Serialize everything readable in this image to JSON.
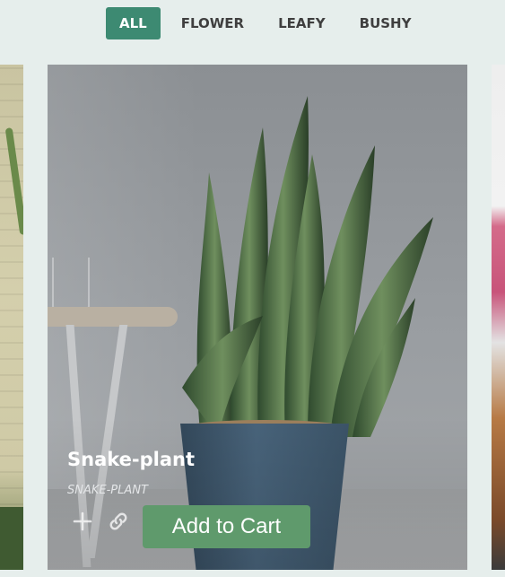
{
  "filters": {
    "all": "ALL",
    "flower": "FLOWER",
    "leafy": "LEAFY",
    "bushy": "BUSHY"
  },
  "product": {
    "name": "Snake-plant",
    "sku": "SNAKE-PLANT",
    "add_to_cart": "Add to Cart"
  },
  "icons": {
    "add": "plus-icon",
    "link": "link-icon"
  },
  "colors": {
    "accent": "#3d8a72",
    "cart_button": "#5f9a6c",
    "background": "#e6eeec"
  }
}
